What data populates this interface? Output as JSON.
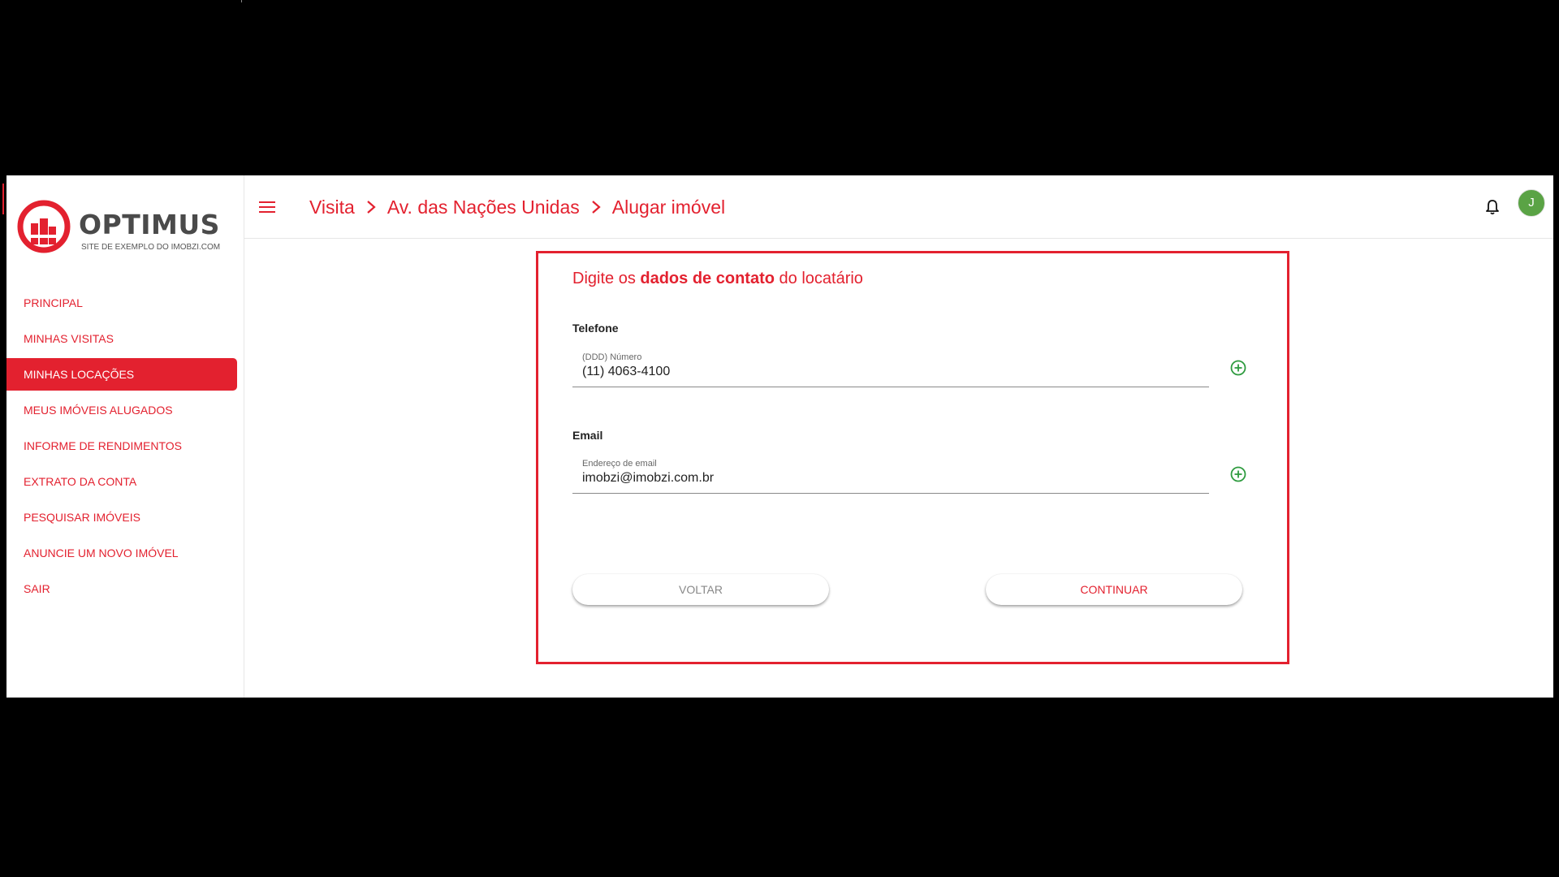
{
  "brand": {
    "name": "OPTIMUS",
    "tagline": "SITE DE EXEMPLO DO IMOBZI.COM",
    "accent_color": "#e3212f"
  },
  "sidebar": {
    "items": [
      {
        "label": "PRINCIPAL",
        "active": false
      },
      {
        "label": "MINHAS VISITAS",
        "active": false
      },
      {
        "label": "MINHAS LOCAÇÕES",
        "active": true
      },
      {
        "label": "MEUS IMÓVEIS ALUGADOS",
        "active": false
      },
      {
        "label": "INFORME DE RENDIMENTOS",
        "active": false
      },
      {
        "label": "EXTRATO DA CONTA",
        "active": false
      },
      {
        "label": "PESQUISAR IMÓVEIS",
        "active": false
      },
      {
        "label": "ANUNCIE UM NOVO IMÓVEL",
        "active": false
      },
      {
        "label": "SAIR",
        "active": false
      }
    ]
  },
  "header": {
    "menu_icon": "hamburger-menu-icon",
    "breadcrumb": [
      "Visita",
      "Av. das Nações Unidas",
      "Alugar imóvel"
    ],
    "separator_icon": "chevron-right-icon",
    "notification_icon": "bell-icon",
    "avatar_initial": "J",
    "avatar_color": "#5aa345"
  },
  "form": {
    "heading_prefix": "Digite os",
    "heading_bold": "dados de contato",
    "heading_suffix": "do locatário",
    "phone": {
      "section_label": "Telefone",
      "field_label": "(DDD) Número",
      "value": "(11) 4063-4100",
      "add_icon": "add-circle-icon"
    },
    "email": {
      "section_label": "Email",
      "field_label": "Endereço de email",
      "value": "imobzi@imobzi.com.br",
      "add_icon": "add-circle-icon"
    },
    "back_label": "VOLTAR",
    "continue_label": "CONTINUAR",
    "add_icon_color": "#2e9b3f"
  }
}
